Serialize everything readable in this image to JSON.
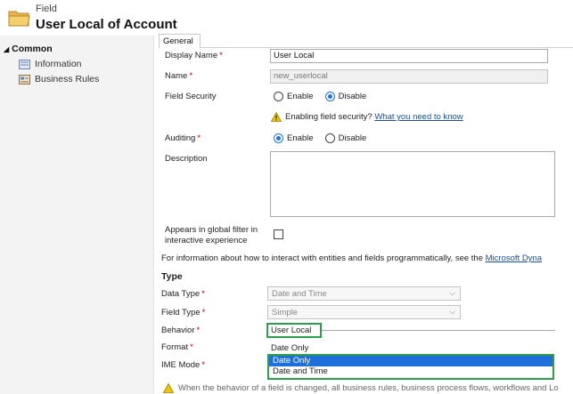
{
  "header": {
    "subtitle": "Field",
    "title": "User Local of Account",
    "icon": "folder-icon"
  },
  "nav": {
    "group": "Common",
    "items": [
      {
        "label": "Information",
        "icon": "information-icon"
      },
      {
        "label": "Business Rules",
        "icon": "business-rules-icon"
      }
    ]
  },
  "tab": {
    "label": "General"
  },
  "form": {
    "display_name": {
      "label": "Display Name",
      "value": "User Local"
    },
    "name": {
      "label": "Name",
      "value": "new_userlocal"
    },
    "field_security": {
      "label": "Field Security",
      "options": [
        "Enable",
        "Disable"
      ],
      "selected": "Disable",
      "warning": "Enabling field security?",
      "warning_link": "What you need to know"
    },
    "auditing": {
      "label": "Auditing",
      "options": [
        "Enable",
        "Disable"
      ],
      "selected": "Enable"
    },
    "description": {
      "label": "Description",
      "value": ""
    },
    "global_filter": {
      "label_line1": "Appears in global filter in",
      "label_line2": "interactive experience"
    },
    "info_text": "For information about how to interact with entities and fields programmatically, see the",
    "info_link": "Microsoft Dyna",
    "type_section": "Type",
    "data_type": {
      "label": "Data Type",
      "value": "Date and Time"
    },
    "field_type": {
      "label": "Field Type",
      "value": "Simple"
    },
    "behavior": {
      "label": "Behavior",
      "value": "User Local"
    },
    "format": {
      "label": "Format",
      "value": "Date Only",
      "options": [
        "Date Only",
        "Date and Time"
      ],
      "highlighted": "Date Only"
    },
    "ime_mode": {
      "label": "IME Mode"
    },
    "bottom_note": "When the behavior of a field is changed, all business rules, business process flows, workflows and Lo"
  },
  "colors": {
    "required": "#c00000",
    "link": "#1a4fa0",
    "highlight_border": "#2e9f48",
    "selected_option": "#1e6fd9",
    "radio_selected": "#1a73e8"
  }
}
